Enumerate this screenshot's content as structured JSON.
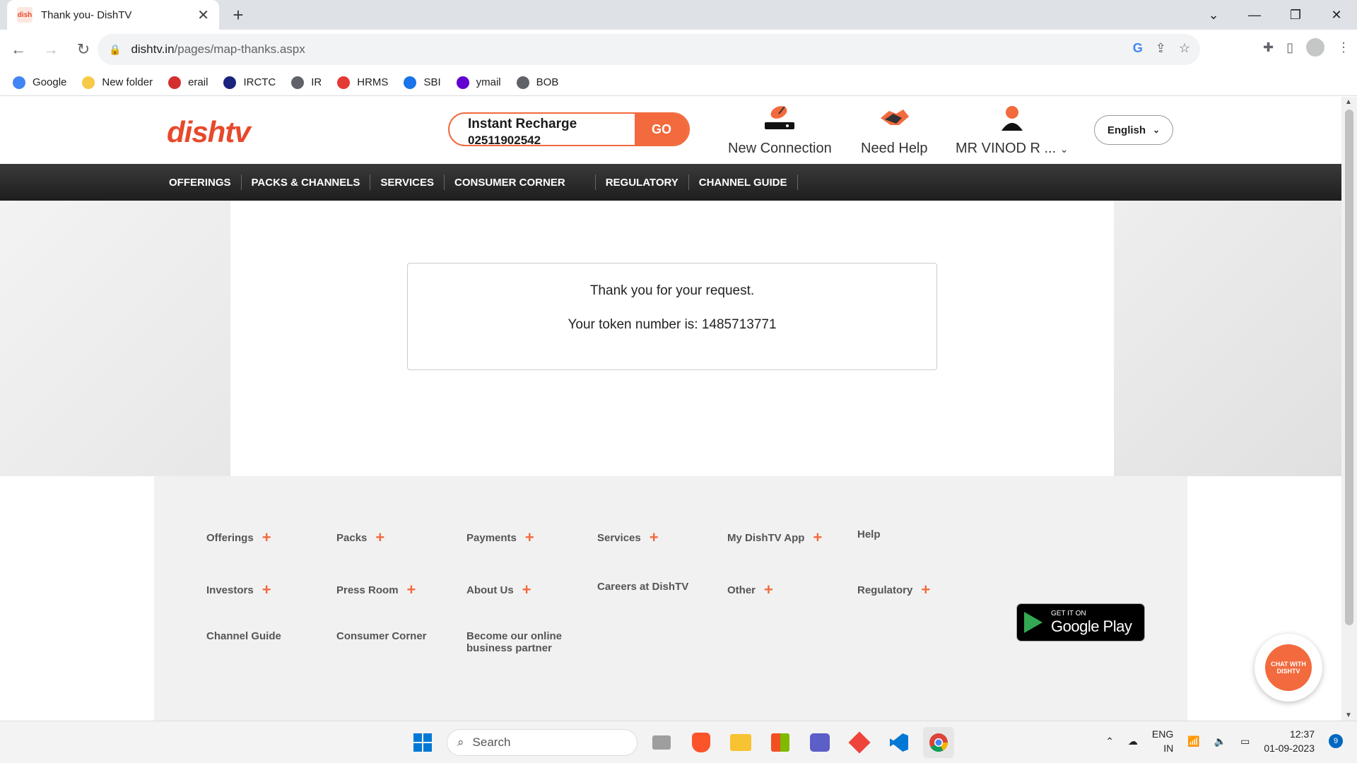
{
  "browser": {
    "tab_title": "Thank you- DishTV",
    "favicon_text": "dish",
    "new_tab": "+",
    "url_domain": "dishtv.in",
    "url_path": "/pages/map-thanks.aspx",
    "bookmarks": [
      {
        "label": "Google",
        "icon": "google-icon",
        "color": "#4285f4"
      },
      {
        "label": "New folder",
        "icon": "folder-icon",
        "color": "#f7c948"
      },
      {
        "label": "erail",
        "icon": "train-icon",
        "color": "#d32f2f"
      },
      {
        "label": "IRCTC",
        "icon": "irctc-icon",
        "color": "#1a237e"
      },
      {
        "label": "IR",
        "icon": "globe-icon",
        "color": "#5f6368"
      },
      {
        "label": "HRMS",
        "icon": "hrms-icon",
        "color": "#e53935"
      },
      {
        "label": "SBI",
        "icon": "sbi-icon",
        "color": "#1a73e8"
      },
      {
        "label": "ymail",
        "icon": "mail-icon",
        "color": "#6001d2"
      },
      {
        "label": "BOB",
        "icon": "globe-icon",
        "color": "#5f6368"
      }
    ]
  },
  "header": {
    "logo_text": "dishtv",
    "recharge_label": "Instant Recharge",
    "recharge_value": "02511902542",
    "go_label": "GO",
    "new_connection": "New Connection",
    "need_help": "Need Help",
    "user_name": "MR VINOD R ...",
    "language": "English"
  },
  "nav": {
    "items": [
      "OFFERINGS",
      "PACKS & CHANNELS",
      "SERVICES",
      "CONSUMER CORNER",
      "REGULATORY",
      "CHANNEL GUIDE"
    ]
  },
  "main": {
    "thanks": "Thank you for your request.",
    "token": "Your token number is: 1485713771"
  },
  "footer": {
    "row1": [
      "Offerings",
      "Packs",
      "Payments",
      "Services",
      "My DishTV App",
      "Help"
    ],
    "row2": [
      "Investors",
      "Press Room",
      "About Us",
      "Careers at DishTV",
      "Other",
      "Regulatory"
    ],
    "row3": [
      "Channel Guide",
      "Consumer Corner",
      "Become our online",
      "business partner"
    ],
    "gplay_small": "GET IT ON",
    "gplay_big": "Google Play",
    "chat_label": "CHAT WITH DISHTV"
  },
  "taskbar": {
    "search_label": "Search",
    "lang_top": "ENG",
    "lang_bottom": "IN",
    "time": "12:37",
    "date": "01-09-2023",
    "notifications": "9"
  },
  "colors": {
    "brand_orange": "#f26a3d",
    "nav_dark": "#2b2b2b"
  }
}
